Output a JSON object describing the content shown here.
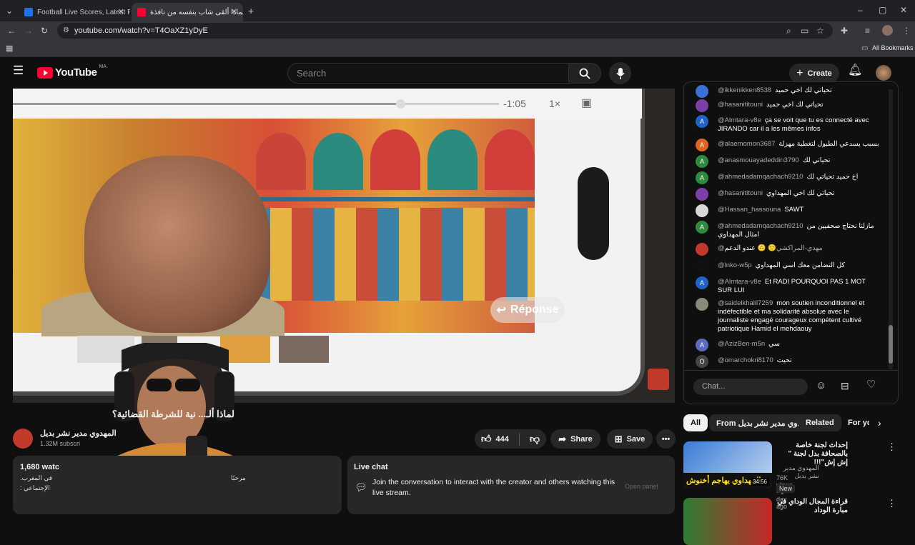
{
  "browser": {
    "tabs": [
      {
        "label": "Football Live Scores, Latest Foo",
        "active": false
      },
      {
        "label": "لماذا ألقى شاب بنفسه من نافذة",
        "active": true
      }
    ],
    "url": "youtube.com/watch?v=T4OaXZ1yDyE",
    "bookmarks_label": "All Bookmarks"
  },
  "header": {
    "logo_text": "YouTube",
    "country": "MA",
    "search_placeholder": "Search",
    "create_label": "Create"
  },
  "player": {
    "phone_time": "-1:05",
    "phone_speed": "1×",
    "overlay_button": "Réponse"
  },
  "video": {
    "title": "لماذا ألـ... نية للشرطة القضائية؟",
    "channel_name": "المهدوي مدير نشر بديل",
    "subscribers": "1.32M subscri",
    "likes": "444",
    "share_label": "Share",
    "save_label": "Save",
    "description_views": "1,680 watc",
    "description_line1": "مرحبًا",
    "description_line2": "في المغرب.",
    "description_line3": "الإجتماعي :"
  },
  "live_chat": {
    "header": "Live chat",
    "cta": "Join the conversation to interact with the creator and others watching this live stream.",
    "open_panel": "Open panel",
    "input_placeholder": "Chat...",
    "messages": [
      {
        "author": "@ikkenikken8538",
        "text": "تحياتي لك اخي حميد",
        "avatar": "",
        "color": "#3a6fd8"
      },
      {
        "author": "@hasanititouni",
        "text": "تحياتي لك اخي حميد",
        "avatar": "",
        "color": "#7b3fa8"
      },
      {
        "author": "@Almtara-v8e",
        "text": "ça se voit que tu es connecté avec JIRANDO car il a les mêmes infos",
        "avatar": "A",
        "color": "#1e63c9"
      },
      {
        "author": "@alaemomon3687",
        "text": "بسبب يسدعي الطبول لتغطية مهزلة",
        "avatar": "A",
        "color": "#e0661f"
      },
      {
        "author": "@anasmouayadeddin3790",
        "text": "تحياتي لك",
        "avatar": "A",
        "color": "#2e8b3e"
      },
      {
        "author": "@ahmedadamqachach9210",
        "text": "اخ حميد تحياتي لك",
        "avatar": "A",
        "color": "#2e8b3e"
      },
      {
        "author": "@hasanititouni",
        "text": "تحياتي لك اخي المهداوي",
        "avatar": "",
        "color": "#7b3fa8"
      },
      {
        "author": "@Hassan_hassouna",
        "text": "SAWT",
        "avatar": "",
        "color": "#d8d8d8"
      },
      {
        "author": "@ahmedadamqachach9210",
        "text": "مازلنا نحتاج صحفيين من امثال المهداوي",
        "avatar": "A",
        "color": "#2e8b3e"
      },
      {
        "author": "@مهدي-المراكشي",
        "text": "🙂 🙃 عندو الدعم",
        "avatar": "",
        "color": "#c0392b"
      },
      {
        "author": "@lnko-w5p",
        "text": "كل التضامن معك اسي المهداوي",
        "avatar": "",
        "color": "#111111"
      },
      {
        "author": "@Almtara-v8e",
        "text": "Et RADI POURQUOI PAS 1 MOT SUR LUI",
        "avatar": "A",
        "color": "#1e63c9"
      },
      {
        "author": "@saidelkhalil7259",
        "text": "mon soutien inconditionnel et indéfectible et ma solidarité absolue avec le journaliste engagé courageux compétent cultivé patriotique Hamid el mehdaouy",
        "avatar": "",
        "color": "#8a8a7a"
      },
      {
        "author": "@AzizBen-m5n",
        "text": "سي",
        "avatar": "A",
        "color": "#5c6bc0"
      },
      {
        "author": "@omarchokri8170",
        "text": "تحيت",
        "avatar": "O",
        "color": "#444444"
      }
    ]
  },
  "chips": [
    "All",
    "From المهدوي مدير نشر بديل",
    "Related",
    "For yo"
  ],
  "recommendations": [
    {
      "title": "إحداث لجنة خاصة بالصحافة بدل لجنة \" إش إش\"!!!",
      "channel": "المهدوي مدير نشر بديل",
      "meta": "76K views • 1 day ago",
      "badge": "New",
      "duration": "34:56",
      "thumb_text": "المهداوي يهاجم أخنوش"
    },
    {
      "title": "قراءة المجال الوداي في مبارة الوداد",
      "channel": "",
      "meta": "",
      "badge": "",
      "duration": "",
      "thumb_text": ""
    }
  ]
}
